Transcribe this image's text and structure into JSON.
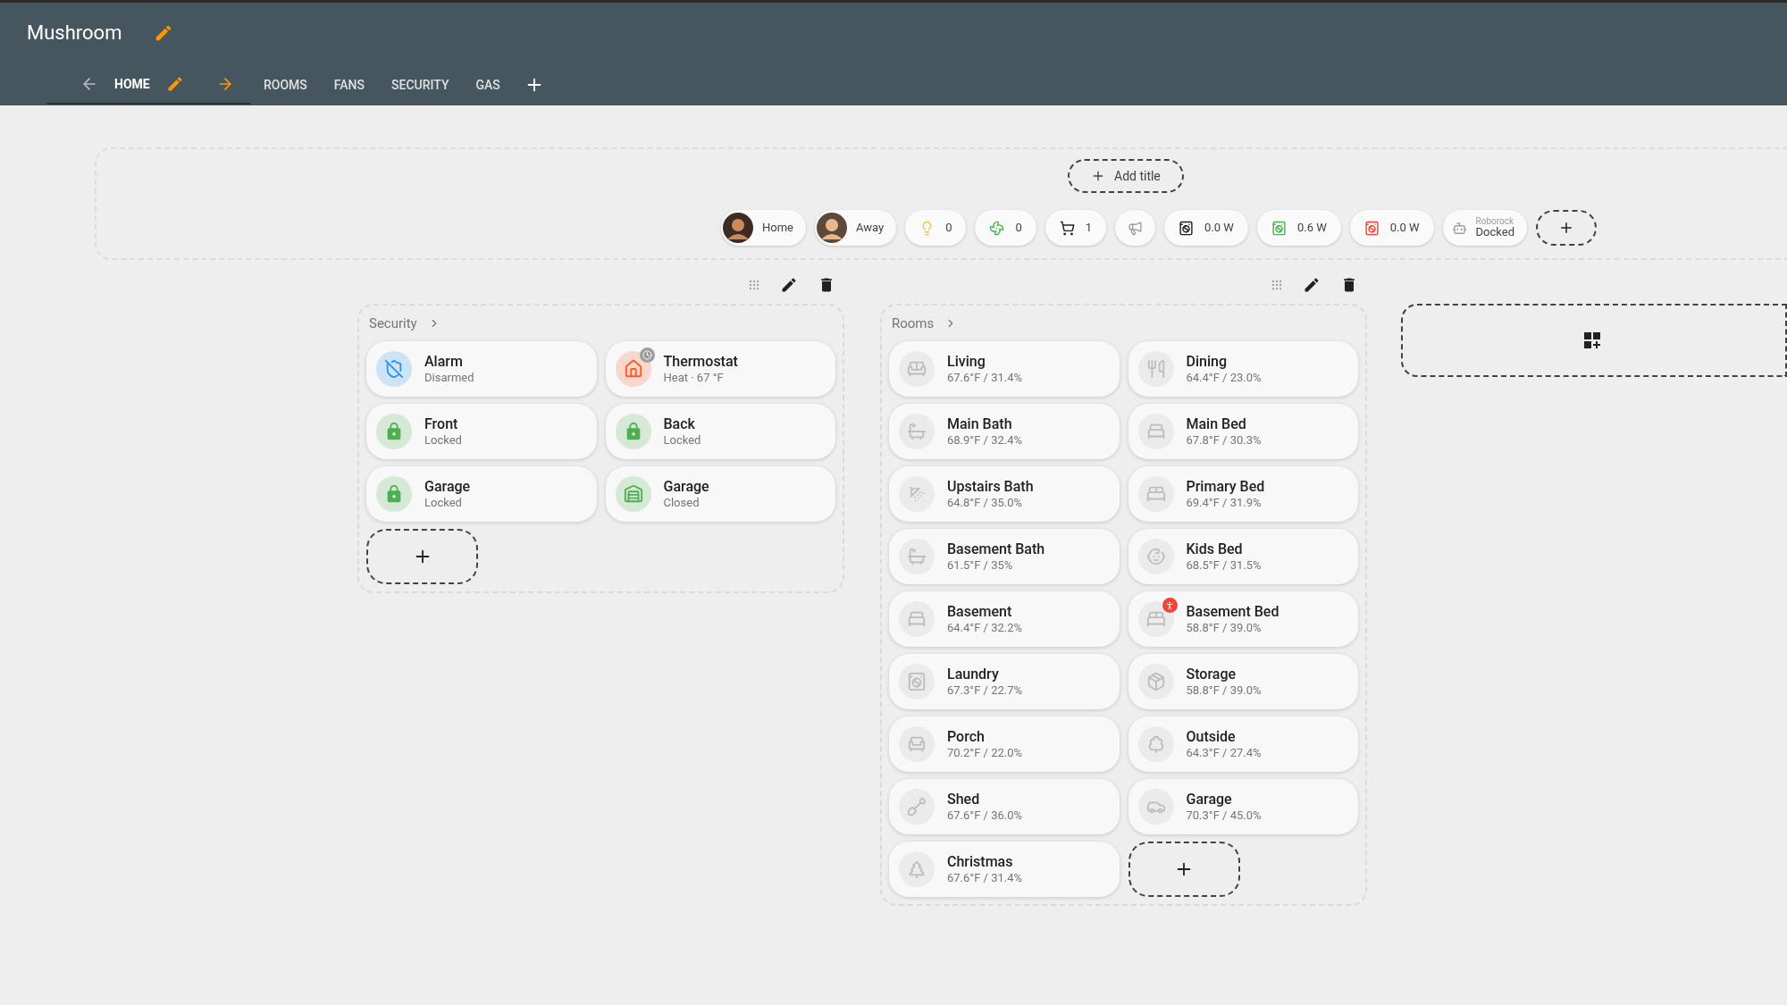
{
  "header": {
    "title": "Mushroom"
  },
  "tabs": [
    {
      "label": "HOME",
      "selected": true
    },
    {
      "label": "ROOMS",
      "selected": false
    },
    {
      "label": "FANS",
      "selected": false
    },
    {
      "label": "SECURITY",
      "selected": false
    },
    {
      "label": "GAS",
      "selected": false
    }
  ],
  "add_title": "Add title",
  "chips": [
    {
      "kind": "person",
      "label": "Home"
    },
    {
      "kind": "person",
      "label": "Away"
    },
    {
      "kind": "value",
      "label": "0"
    },
    {
      "kind": "value",
      "label": "0"
    },
    {
      "kind": "value",
      "label": "1"
    },
    {
      "kind": "icon"
    },
    {
      "kind": "value",
      "label": "0.0 W"
    },
    {
      "kind": "value",
      "label": "0.6 W"
    },
    {
      "kind": "value",
      "label": "0.0 W"
    },
    {
      "kind": "two-line",
      "secondary": "Roborock",
      "label": "Docked"
    }
  ],
  "sections": [
    {
      "title": "Security",
      "entities": [
        {
          "name": "Alarm",
          "state": "Disarmed",
          "color": "#2196f3"
        },
        {
          "name": "Thermostat",
          "state": "Heat · 67 °F",
          "color": "#ff5722",
          "badge": {
            "kind": "clock"
          }
        },
        {
          "name": "Front",
          "state": "Locked",
          "color": "#4caf50"
        },
        {
          "name": "Back",
          "state": "Locked",
          "color": "#4caf50"
        },
        {
          "name": "Garage",
          "state": "Locked",
          "color": "#4caf50"
        },
        {
          "name": "Garage",
          "state": "Closed",
          "color": "#4caf50"
        }
      ]
    },
    {
      "title": "Rooms",
      "entities": [
        {
          "name": "Living",
          "state": "67.6°F / 31.4%"
        },
        {
          "name": "Dining",
          "state": "64.4°F / 23.0%"
        },
        {
          "name": "Main Bath",
          "state": "68.9°F / 32.4%"
        },
        {
          "name": "Main Bed",
          "state": "67.8°F / 30.3%"
        },
        {
          "name": "Upstairs Bath",
          "state": "64.8°F / 35.0%"
        },
        {
          "name": "Primary Bed",
          "state": "69.4°F / 31.9%"
        },
        {
          "name": "Basement Bath",
          "state": "61.5°F / 35%"
        },
        {
          "name": "Kids Bed",
          "state": "68.5°F / 31.5%"
        },
        {
          "name": "Basement",
          "state": "64.4°F / 32.2%"
        },
        {
          "name": "Basement Bed",
          "state": "58.8°F / 39.0%",
          "badge": {
            "kind": "alert"
          }
        },
        {
          "name": "Laundry",
          "state": "67.3°F / 22.7%"
        },
        {
          "name": "Storage",
          "state": "58.8°F / 39.0%"
        },
        {
          "name": "Porch",
          "state": "70.2°F / 22.0%"
        },
        {
          "name": "Outside",
          "state": "64.3°F / 27.4%"
        },
        {
          "name": "Shed",
          "state": "67.6°F / 36.0%"
        },
        {
          "name": "Garage",
          "state": "70.3°F / 45.0%"
        },
        {
          "name": "Christmas",
          "state": "67.6°F / 31.4%"
        }
      ]
    }
  ]
}
